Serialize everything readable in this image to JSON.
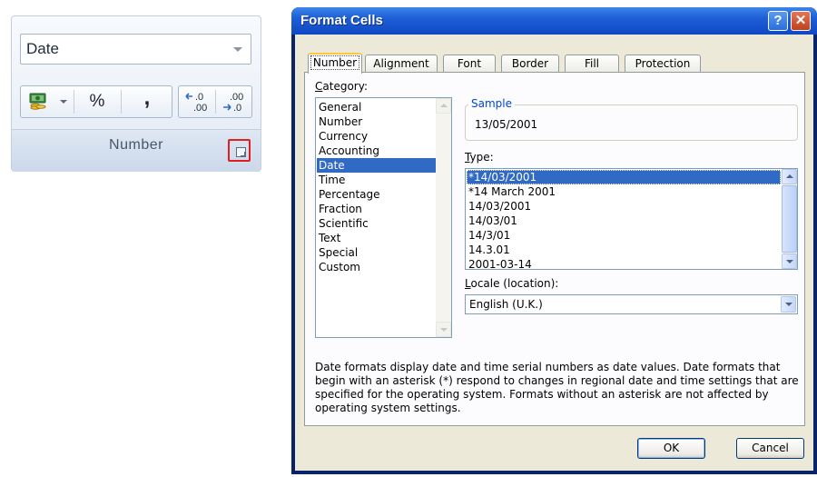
{
  "ribbon": {
    "format_value": "Date",
    "percent_label": "%",
    "comma_label": ",",
    "group_label": "Number",
    "icons": [
      "accounting-format-icon",
      "dropdown-arrow-icon",
      "increase-decimal-icon",
      "decrease-decimal-icon",
      "dialog-launcher-icon"
    ]
  },
  "dialog": {
    "title": "Format Cells",
    "help_label": "?",
    "close_label": "✕",
    "tabs": [
      {
        "label": "Number",
        "active": true
      },
      {
        "label": "Alignment"
      },
      {
        "label": "Font"
      },
      {
        "label": "Border"
      },
      {
        "label": "Fill"
      },
      {
        "label": "Protection"
      }
    ],
    "category_label_pre": "",
    "category_label_u": "C",
    "category_label_post": "ategory:",
    "categories": [
      "General",
      "Number",
      "Currency",
      "Accounting",
      "Date",
      "Time",
      "Percentage",
      "Fraction",
      "Scientific",
      "Text",
      "Special",
      "Custom"
    ],
    "selected_category": "Date",
    "sample_label": "Sample",
    "sample_value": "13/05/2001",
    "type_label_u": "T",
    "type_label_post": "ype:",
    "types": [
      "*14/03/2001",
      "*14 March 2001",
      "14/03/2001",
      "14/03/01",
      "14/3/01",
      "14.3.01",
      "2001-03-14"
    ],
    "selected_type": "*14/03/2001",
    "locale_label_u": "L",
    "locale_label_post": "ocale (location):",
    "locale_value": "English (U.K.)",
    "description": "Date formats display date and time serial numbers as date values.  Date formats that begin with an asterisk (*) respond to changes in regional date and time settings that are specified for the operating system. Formats without an asterisk are not affected by operating system settings.",
    "ok_label": "OK",
    "cancel_label": "Cancel"
  },
  "colors": {
    "selection": "#316ac5",
    "titlebar": "#1e5ed6",
    "highlight_box": "#e02020",
    "dialog_face": "#ece9d8"
  }
}
